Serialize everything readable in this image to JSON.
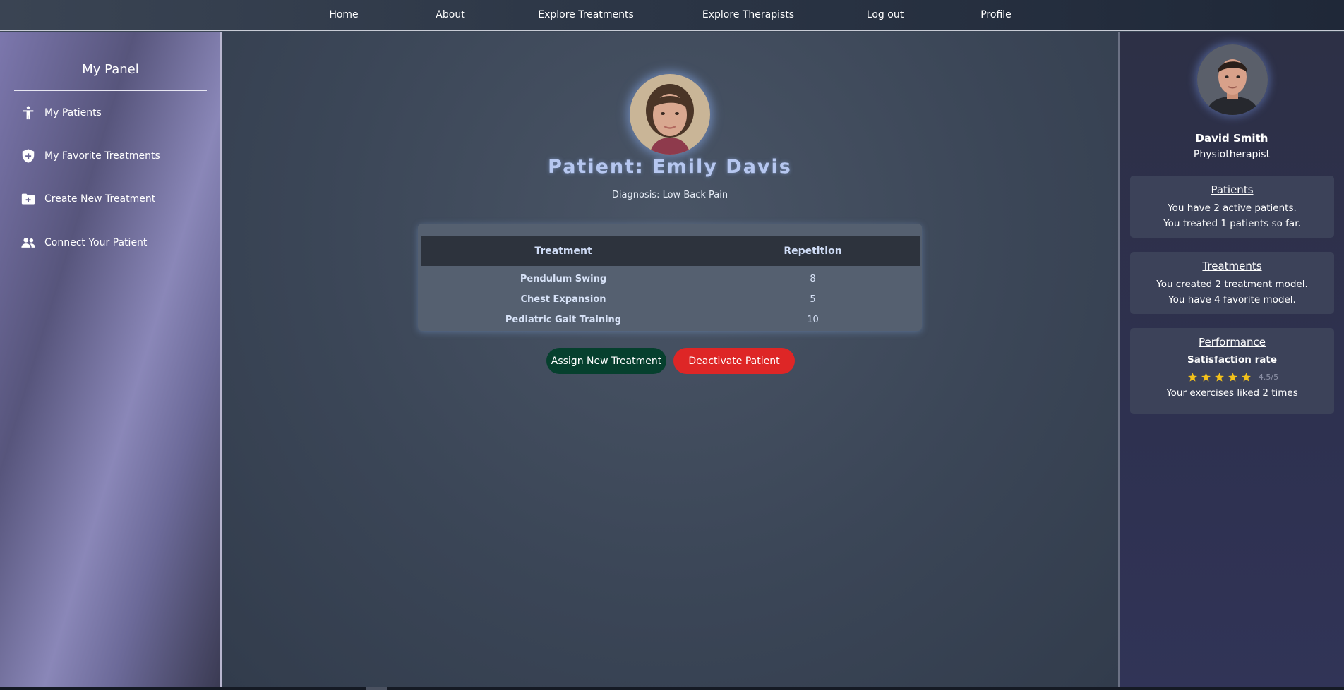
{
  "nav": {
    "items": [
      {
        "label": "Home"
      },
      {
        "label": "About"
      },
      {
        "label": "Explore Treatments"
      },
      {
        "label": "Explore Therapists"
      },
      {
        "label": "Log out"
      },
      {
        "label": "Profile"
      }
    ]
  },
  "sidebar": {
    "title": "My Panel",
    "items": [
      {
        "label": "My Patients",
        "icon": "person-icon"
      },
      {
        "label": "My Favorite Treatments",
        "icon": "shield-plus-icon"
      },
      {
        "label": "Create New Treatment",
        "icon": "folder-plus-icon"
      },
      {
        "label": "Connect Your Patient",
        "icon": "users-icon"
      }
    ]
  },
  "main": {
    "patient_title": "Patient: Emily Davis",
    "diagnosis": "Diagnosis: Low Back Pain",
    "table": {
      "headers": [
        "Treatment",
        "Repetition"
      ],
      "rows": [
        {
          "treatment": "Pendulum Swing",
          "repetition": "8"
        },
        {
          "treatment": "Chest Expansion",
          "repetition": "5"
        },
        {
          "treatment": "Pediatric Gait Training",
          "repetition": "10"
        }
      ]
    },
    "buttons": {
      "assign": "Assign New Treatment",
      "deactivate": "Deactivate Patient"
    }
  },
  "therapist": {
    "name": "David Smith",
    "role": "Physiotherapist",
    "patients_card": {
      "title": "Patients",
      "line1": "You have 2 active patients.",
      "line2": "You treated 1 patients so far."
    },
    "treatments_card": {
      "title": "Treatments",
      "line1": "You created 2 treatment model.",
      "line2": "You have 4 favorite model."
    },
    "performance_card": {
      "title": "Performance",
      "subtitle": "Satisfaction rate",
      "rating": 4.5,
      "rating_text": "4.5/5",
      "likes": "Your exercises liked 2 times"
    }
  },
  "colors": {
    "assign_button": "#06402e",
    "deactivate_button": "#de2626",
    "star": "#f3c11a",
    "title_accent": "#b6c7f0"
  }
}
